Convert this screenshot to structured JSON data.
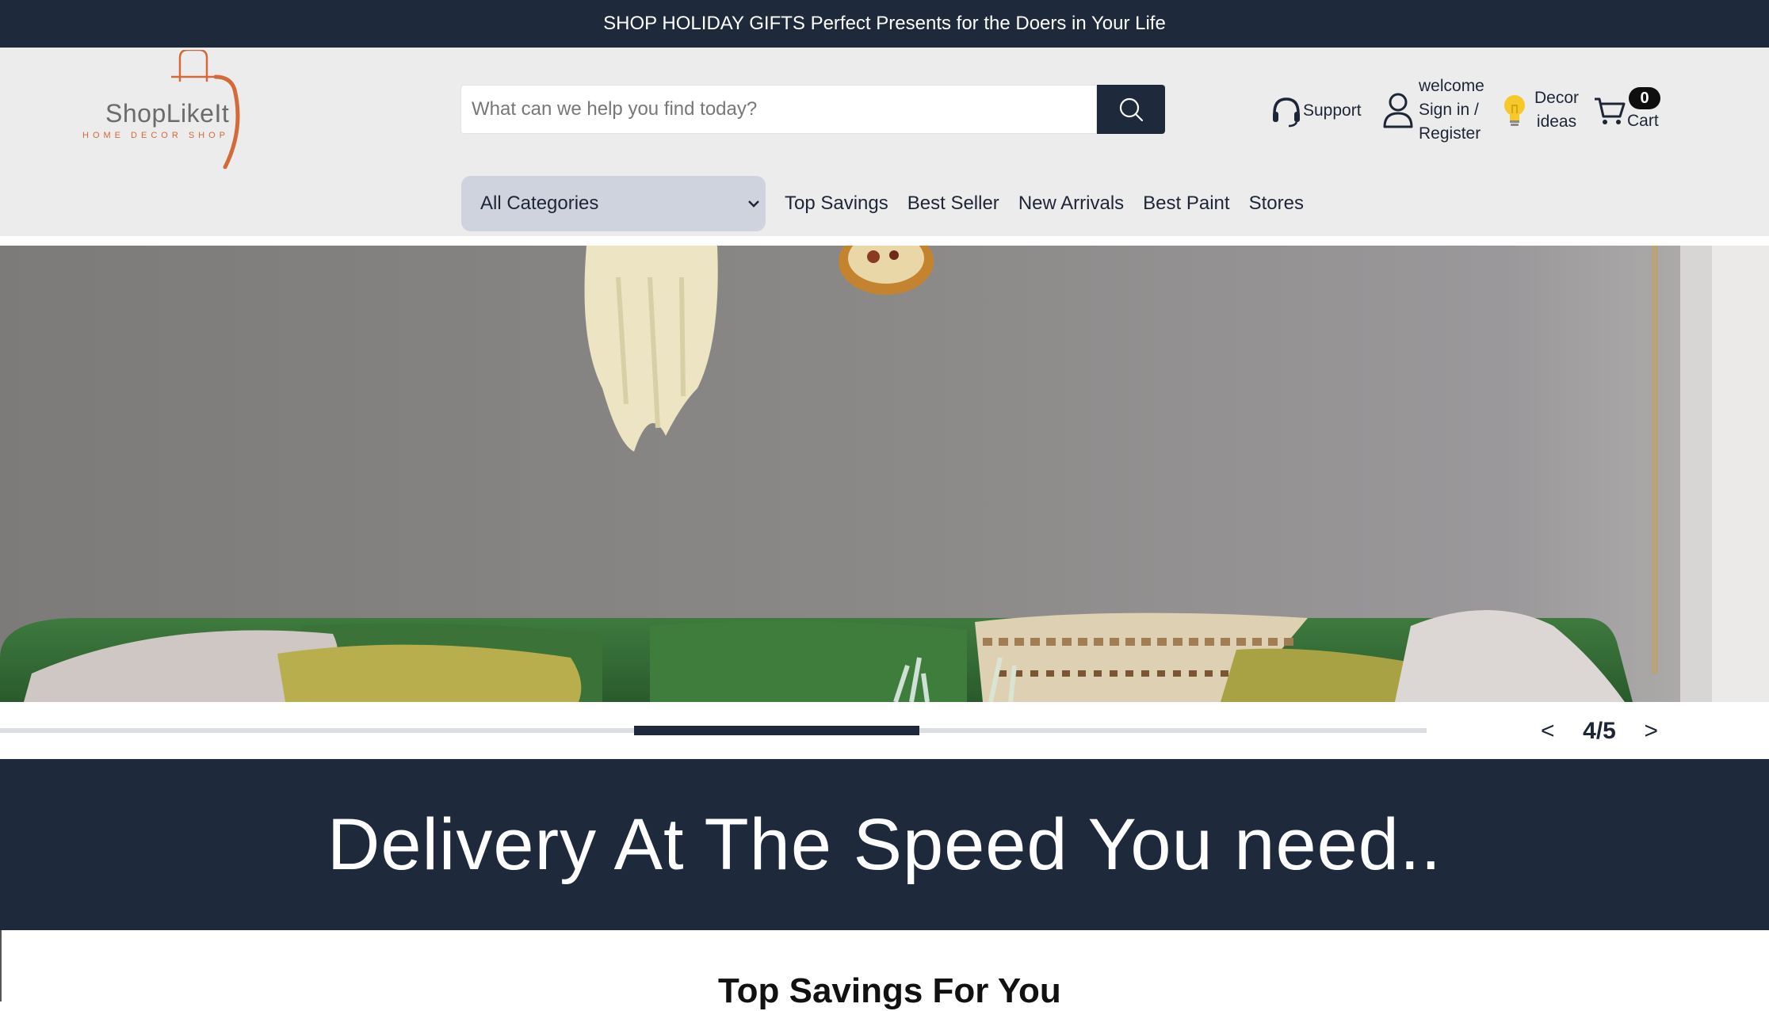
{
  "promo": {
    "text": "SHOP HOLIDAY GIFTS Perfect Presents for the Doers in Your Life"
  },
  "logo": {
    "name": "ShopLikeIt",
    "tagline": "HOME DECOR SHOP",
    "colors": {
      "arc": "#d4693a",
      "text": "#6b6b6b"
    }
  },
  "search": {
    "placeholder": "What can we help you find today?",
    "value": "",
    "button_icon": "search-icon"
  },
  "utility": {
    "support_label": "Support",
    "support_icon": "headset-icon",
    "account_welcome": "welcome",
    "account_signin": "Sign in /",
    "account_register": "Register",
    "account_icon": "user-icon",
    "decor_line1": "Decor",
    "decor_line2": "ideas",
    "decor_icon": "lightbulb-icon",
    "cart_label": "Cart",
    "cart_count": "0",
    "cart_icon": "cart-icon"
  },
  "nav": {
    "category_select": "All Categories",
    "links": [
      "Top Savings",
      "Best Seller",
      "New Arrivals",
      "Best Paint",
      "Stores"
    ]
  },
  "slider": {
    "current": 4,
    "total": 5,
    "counter_text": "4/5",
    "prev_label": "<",
    "next_label": ">"
  },
  "delivery": {
    "headline": "Delivery At The Speed You need.."
  },
  "section": {
    "heading": "Top Savings For You"
  },
  "colors": {
    "navy": "#1e293b",
    "header_bg": "#ececec",
    "category_bg": "#cfd3de"
  }
}
